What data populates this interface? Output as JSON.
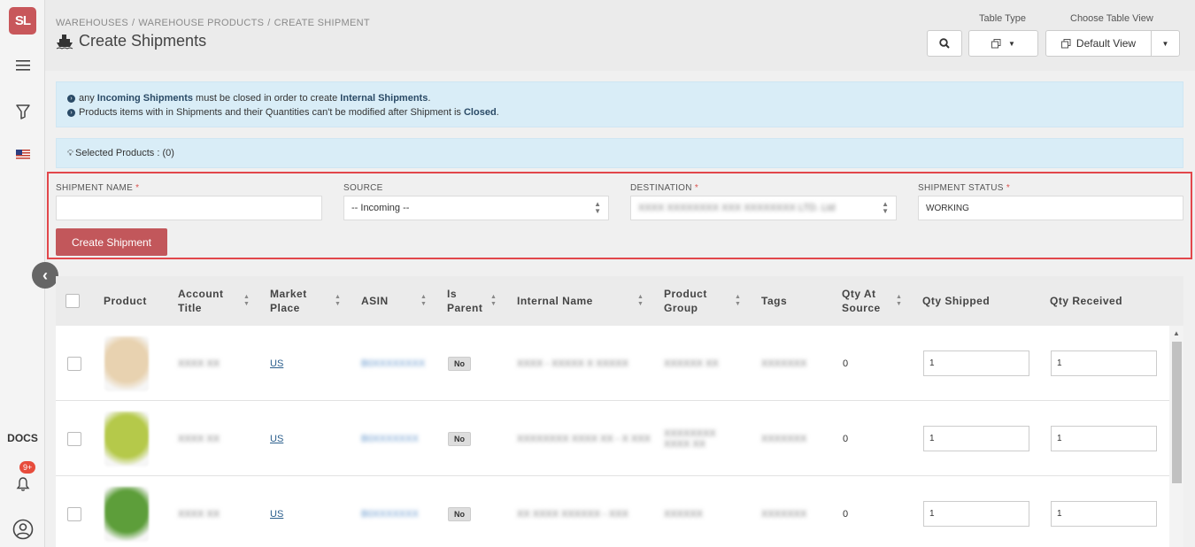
{
  "sidebar": {
    "logo_text": "SL",
    "docs_label": "DOCS",
    "notification_count": "9+"
  },
  "breadcrumb": [
    "WAREHOUSES",
    "WAREHOUSE PRODUCTS",
    "CREATE SHIPMENT"
  ],
  "page_title": "Create Shipments",
  "controls": {
    "table_type_label": "Table Type",
    "choose_view_label": "Choose Table View",
    "default_view": "Default View"
  },
  "info": {
    "line1_pre": "any ",
    "line1_bold1": "Incoming Shipments",
    "line1_mid": " must be closed in order to create ",
    "line1_bold2": "Internal Shipments",
    "line1_end": ".",
    "line2_pre": "Products items with in Shipments and their Quantities can't be modified after Shipment is ",
    "line2_bold": "Closed",
    "line2_end": ".",
    "selected_products": "Selected Products : (0)"
  },
  "form": {
    "shipment_name_label": "SHIPMENT NAME",
    "shipment_name_value": "",
    "source_label": "SOURCE",
    "source_value": "-- Incoming --",
    "destination_label": "DESTINATION",
    "destination_value": "XXXX XXXXXXXX XXX XXXXXXXX LTD. Ltd",
    "status_label": "SHIPMENT STATUS",
    "status_value": "WORKING",
    "required_mark": "*",
    "create_button": "Create Shipment"
  },
  "table": {
    "columns": {
      "product": "Product",
      "account_title_1": "Account",
      "account_title_2": "Title",
      "market_place_1": "Market",
      "market_place_2": "Place",
      "asin": "ASIN",
      "is_parent_1": "Is",
      "is_parent_2": "Parent",
      "internal_name": "Internal Name",
      "product_group_1": "Product",
      "product_group_2": "Group",
      "tags": "Tags",
      "qty_at_source_1": "Qty At",
      "qty_at_source_2": "Source",
      "qty_shipped": "Qty Shipped",
      "qty_received": "Qty Received"
    },
    "rows": [
      {
        "account": "XXXX XX",
        "market": "US",
        "asin": "B0XXXXXXXX",
        "is_parent": "No",
        "internal_name": "XXXX - XXXXX X XXXXX",
        "group": "XXXXXX XX",
        "tags": "XXXXXXX",
        "qty_source": "0",
        "qty_shipped": "1",
        "qty_received": "1",
        "thumb_color": "#e8d2b0"
      },
      {
        "account": "XXXX XX",
        "market": "US",
        "asin": "B0XXXXXXX",
        "is_parent": "No",
        "internal_name": "XXXXXXXX XXXX XX - X XXX",
        "group": "XXXXXXXX XXXX XX",
        "tags": "XXXXXXX",
        "qty_source": "0",
        "qty_shipped": "1",
        "qty_received": "1",
        "thumb_color": "#b5c94a"
      },
      {
        "account": "XXXX XX",
        "market": "US",
        "asin": "B0XXXXXXX",
        "is_parent": "No",
        "internal_name": "XX XXXX XXXXXX - XXX",
        "group": "XXXXXX",
        "tags": "XXXXXXX",
        "qty_source": "0",
        "qty_shipped": "1",
        "qty_received": "1",
        "thumb_color": "#5d9e3a"
      }
    ]
  },
  "colors": {
    "brand": "#c8575b",
    "highlight_border": "#e2474b",
    "info_bg": "#d9edf7"
  }
}
